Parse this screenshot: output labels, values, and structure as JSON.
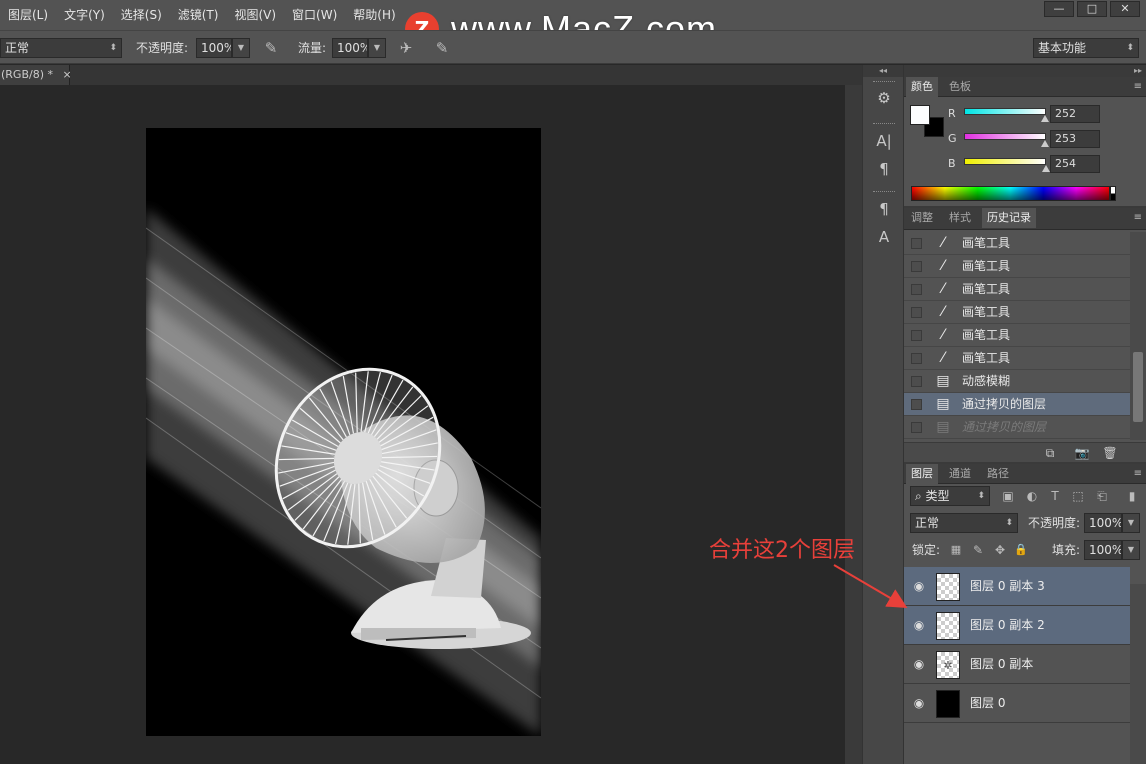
{
  "menu": [
    "图层(L)",
    "文字(Y)",
    "选择(S)",
    "滤镜(T)",
    "视图(V)",
    "窗口(W)",
    "帮助(H)"
  ],
  "window_controls": {
    "minimize": "—",
    "maximize": "□",
    "close": "✕"
  },
  "watermark": {
    "logo": "Z",
    "text": "www.MacZ.com"
  },
  "options": {
    "mode": "正常",
    "opacity_label": "不透明度:",
    "opacity": "100%",
    "flow_label": "流量:",
    "flow": "100%",
    "workspace": "基本功能"
  },
  "document_tab": {
    "title": "(RGB/8) *",
    "close": "×"
  },
  "color_panel": {
    "tabs": [
      "颜色",
      "色板"
    ],
    "channels": [
      {
        "label": "R",
        "value": "252",
        "fraction": 0.988,
        "color": "#00e5e5"
      },
      {
        "label": "G",
        "value": "253",
        "fraction": 0.992,
        "color": "#e030e0"
      },
      {
        "label": "B",
        "value": "254",
        "fraction": 0.996,
        "color": "#f0f000"
      }
    ]
  },
  "history_panel": {
    "tabs": [
      "调整",
      "样式",
      "历史记录"
    ],
    "items": [
      {
        "label": "画笔工具",
        "icon": "brush-icon"
      },
      {
        "label": "画笔工具",
        "icon": "brush-icon"
      },
      {
        "label": "画笔工具",
        "icon": "brush-icon"
      },
      {
        "label": "画笔工具",
        "icon": "brush-icon"
      },
      {
        "label": "画笔工具",
        "icon": "brush-icon"
      },
      {
        "label": "画笔工具",
        "icon": "brush-icon"
      },
      {
        "label": "动感模糊",
        "icon": "document-icon"
      },
      {
        "label": "通过拷贝的图层",
        "icon": "document-icon"
      },
      {
        "label": "通过拷贝的图层",
        "icon": "document-icon"
      }
    ],
    "selected_index": 7,
    "dimmed_index": 8
  },
  "layers_panel": {
    "tabs": [
      "图层",
      "通道",
      "路径"
    ],
    "filter_label": "类型",
    "blend_mode": "正常",
    "opacity_label": "不透明度:",
    "opacity": "100%",
    "lock_label": "锁定:",
    "fill_label": "填充:",
    "fill": "100%",
    "layers": [
      {
        "name": "图层 0 副本 3",
        "selected": true,
        "thumb": "transparent"
      },
      {
        "name": "图层 0 副本 2",
        "selected": true,
        "thumb": "transparent"
      },
      {
        "name": "图层 0 副本",
        "selected": false,
        "thumb": "fan"
      },
      {
        "name": "图层 0",
        "selected": false,
        "thumb": "black"
      }
    ]
  },
  "annotation": {
    "text": "合并这2个图层",
    "color": "#e8403a"
  }
}
